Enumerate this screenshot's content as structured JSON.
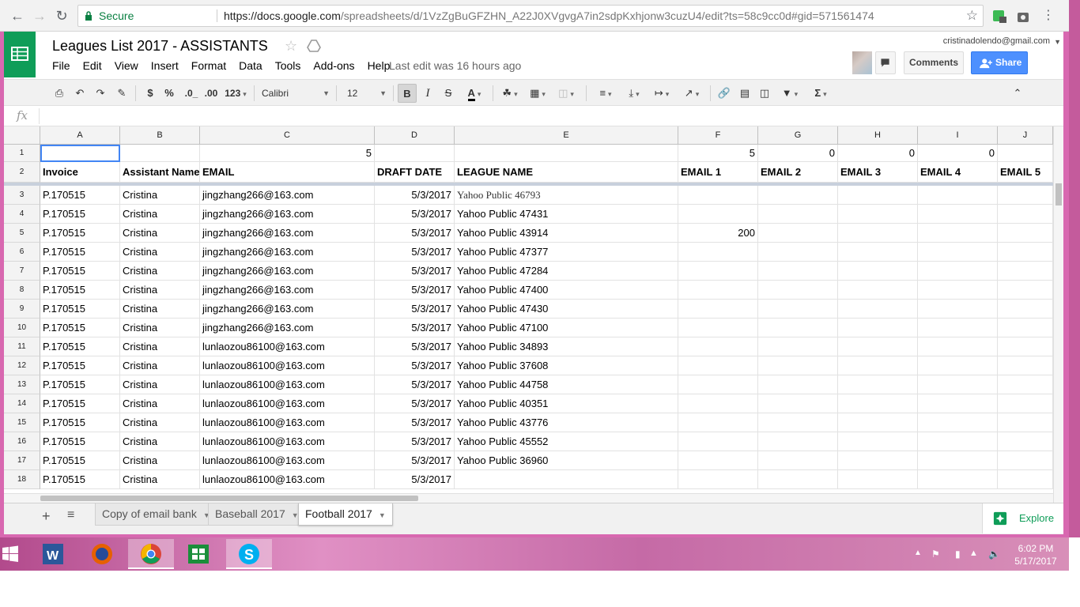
{
  "browser": {
    "secure_label": "Secure",
    "url_host": "https://docs.google.com",
    "url_path": "/spreadsheets/d/1VzZgBuGFZHN_A22J0XVgvgA7in2sdpKxhjonw3cuzU4/edit?ts=58c9cc0d#gid=571561474"
  },
  "doc": {
    "title": "Leagues List 2017 - ASSISTANTS",
    "last_edit": "Last edit was 16 hours ago",
    "account": "cristinadolendo@gmail.com"
  },
  "menu": [
    "File",
    "Edit",
    "View",
    "Insert",
    "Format",
    "Data",
    "Tools",
    "Add-ons",
    "Help"
  ],
  "header_buttons": {
    "comments": "Comments",
    "share": "Share"
  },
  "toolbar": {
    "currency": "$",
    "percent": "%",
    "dec_decrease": ".0_",
    "dec_increase": ".00",
    "more_formats": "123",
    "font": "Calibri",
    "font_size": "12",
    "bold": "B",
    "italic": "I",
    "strike": "S",
    "text_color": "A"
  },
  "formula_bar": {
    "fx": "fx"
  },
  "columns": [
    "A",
    "B",
    "C",
    "D",
    "E",
    "F",
    "G",
    "H",
    "I",
    "J"
  ],
  "row_numbers": [
    "1",
    "2",
    "3",
    "4",
    "5",
    "6",
    "7",
    "8",
    "9",
    "10",
    "11",
    "12",
    "13",
    "14",
    "15",
    "16",
    "17",
    "18"
  ],
  "row1": {
    "C": "5",
    "F": "5",
    "G": "0",
    "H": "0",
    "I": "0"
  },
  "header_row": [
    "Invoice",
    "Assistant Name",
    "EMAIL",
    "DRAFT DATE",
    "LEAGUE NAME",
    "EMAIL 1",
    "EMAIL 2",
    "EMAIL 3",
    "EMAIL 4",
    "EMAIL 5"
  ],
  "rows": [
    [
      "P.170515",
      "Cristina",
      "jingzhang266@163.com",
      "5/3/2017",
      "Yahoo Public 46793",
      ""
    ],
    [
      "P.170515",
      "Cristina",
      "jingzhang266@163.com",
      "5/3/2017",
      "Yahoo Public 47431",
      ""
    ],
    [
      "P.170515",
      "Cristina",
      "jingzhang266@163.com",
      "5/3/2017",
      "Yahoo Public 43914",
      "200"
    ],
    [
      "P.170515",
      "Cristina",
      "jingzhang266@163.com",
      "5/3/2017",
      "Yahoo Public 47377",
      ""
    ],
    [
      "P.170515",
      "Cristina",
      "jingzhang266@163.com",
      "5/3/2017",
      "Yahoo Public 47284",
      ""
    ],
    [
      "P.170515",
      "Cristina",
      "jingzhang266@163.com",
      "5/3/2017",
      "Yahoo Public 47400",
      ""
    ],
    [
      "P.170515",
      "Cristina",
      "jingzhang266@163.com",
      "5/3/2017",
      "Yahoo Public 47430",
      ""
    ],
    [
      "P.170515",
      "Cristina",
      "jingzhang266@163.com",
      "5/3/2017",
      "Yahoo Public 47100",
      ""
    ],
    [
      "P.170515",
      "Cristina",
      "lunlaozou86100@163.com",
      "5/3/2017",
      "Yahoo Public 34893",
      ""
    ],
    [
      "P.170515",
      "Cristina",
      "lunlaozou86100@163.com",
      "5/3/2017",
      "Yahoo Public 37608",
      ""
    ],
    [
      "P.170515",
      "Cristina",
      "lunlaozou86100@163.com",
      "5/3/2017",
      "Yahoo Public 44758",
      ""
    ],
    [
      "P.170515",
      "Cristina",
      "lunlaozou86100@163.com",
      "5/3/2017",
      "Yahoo Public 40351",
      ""
    ],
    [
      "P.170515",
      "Cristina",
      "lunlaozou86100@163.com",
      "5/3/2017",
      "Yahoo Public 43776",
      ""
    ],
    [
      "P.170515",
      "Cristina",
      "lunlaozou86100@163.com",
      "5/3/2017",
      "Yahoo Public 45552",
      ""
    ],
    [
      "P.170515",
      "Cristina",
      "lunlaozou86100@163.com",
      "5/3/2017",
      "Yahoo Public 36960",
      ""
    ],
    [
      "P.170515",
      "Cristina",
      "lunlaozou86100@163.com",
      "5/3/2017",
      "",
      ""
    ]
  ],
  "sheet_tabs": [
    "Copy of email bank",
    "Baseball 2017",
    "Football 2017"
  ],
  "active_tab": "Football 2017",
  "explore": "Explore",
  "taskbar": {
    "time": "6:02 PM",
    "date": "5/17/2017"
  },
  "colors": {
    "sheets_green": "#0f9d58",
    "share_blue": "#4d90fe",
    "selection_blue": "#4285f4",
    "desktop_pink": "#d868b0"
  }
}
